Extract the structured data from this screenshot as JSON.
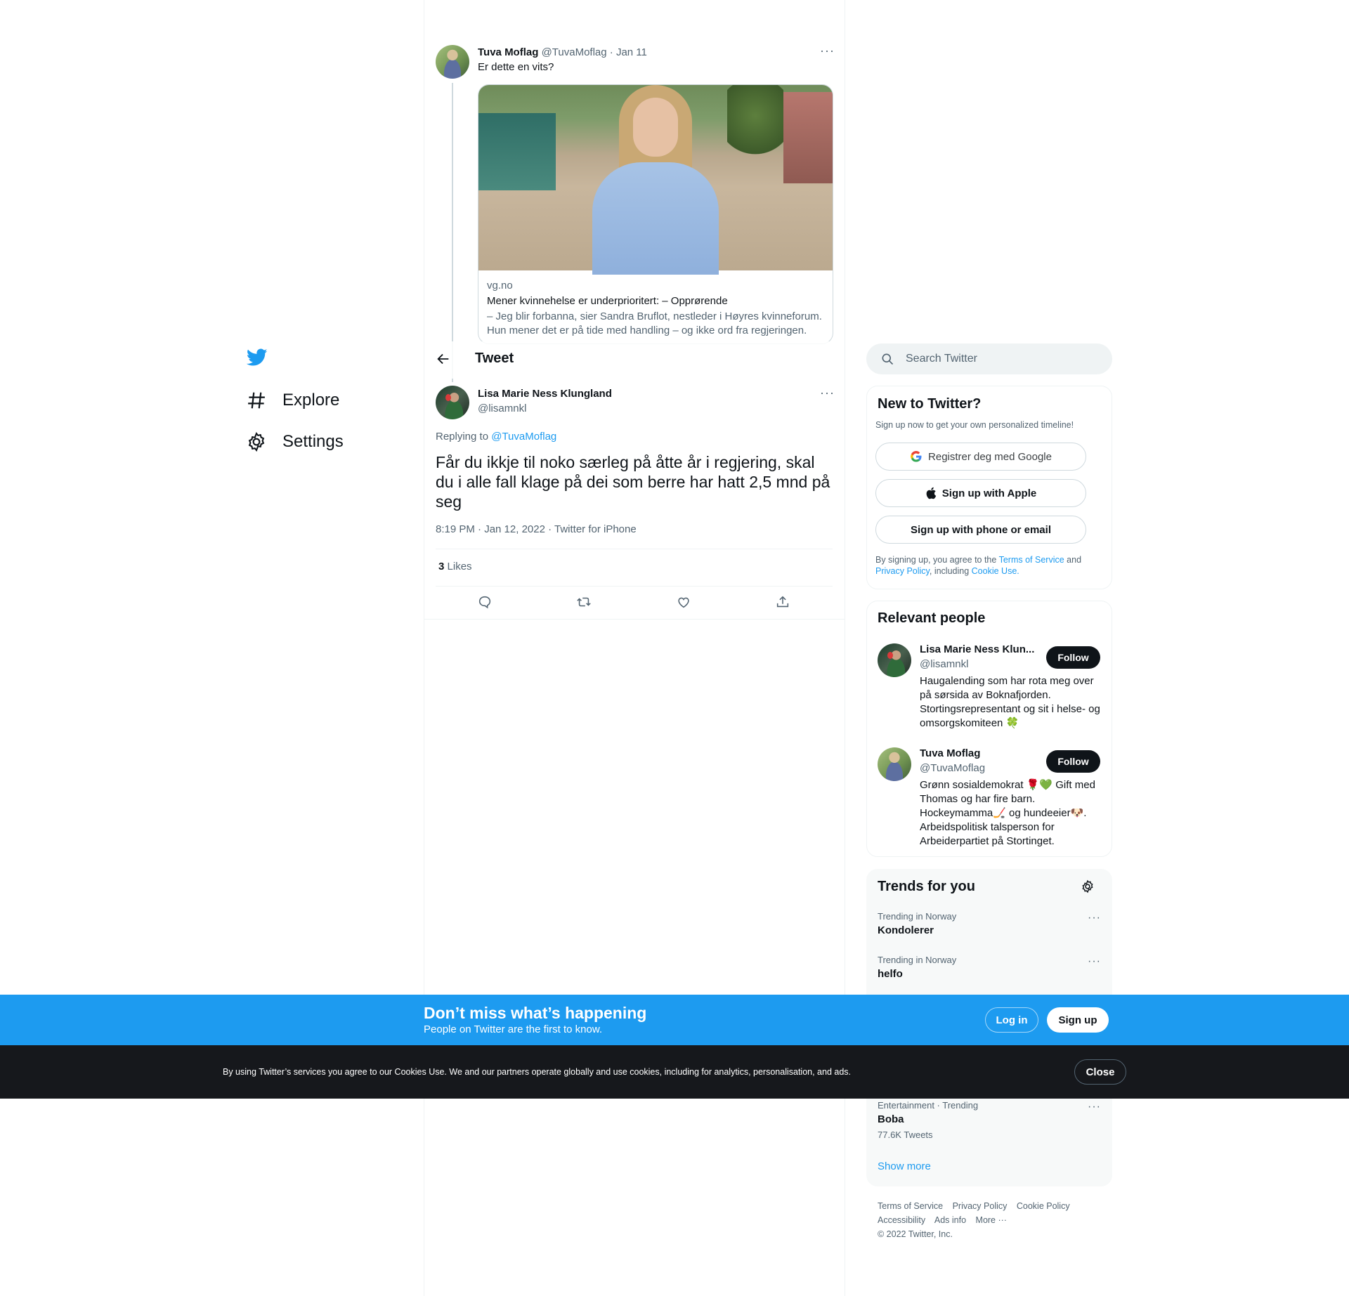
{
  "nav": {
    "explore_label": "Explore",
    "settings_label": "Settings"
  },
  "header": {
    "title": "Tweet"
  },
  "parent_tweet": {
    "name": "Tuva Moflag",
    "handle": "@TuvaMoflag",
    "date": "· Jan 11",
    "text": "Er dette en vits?",
    "card": {
      "domain": "vg.no",
      "title": "Mener kvinnehelse er underprioritert: – Opprørende",
      "description_line1": "– Jeg blir forbanna, sier Sandra Bruflot, nestleder i Høyres kvinneforum.",
      "description_line2": "Hun mener det er på tide med handling – og ikke ord fra regjeringen."
    }
  },
  "main_tweet": {
    "name": "Lisa Marie Ness Klungland",
    "handle": "@lisamnkl",
    "replying_prefix": "Replying to",
    "replying_to": "@TuvaMoflag",
    "text": "Får du ikkje til noko særleg på åtte år i regjering, skal du i alle fall klage på dei som berre har hatt 2,5 mnd på seg",
    "meta": "8:19 PM · Jan 12, 2022 · Twitter for iPhone",
    "likes_count": "3",
    "likes_label": "Likes"
  },
  "search": {
    "placeholder": "Search Twitter"
  },
  "signup": {
    "title": "New to Twitter?",
    "subtitle": "Sign up now to get your own personalized timeline!",
    "google_label": "Registrer deg med Google",
    "apple_label": "Sign up with Apple",
    "phone_label": "Sign up with phone or email",
    "legal_prefix": "By signing up, you agree to the",
    "terms": "Terms of Service",
    "and": "and",
    "privacy": "Privacy Policy",
    "including": ", including",
    "cookie": "Cookie Use."
  },
  "relevant": {
    "title": "Relevant people",
    "people": [
      {
        "name": "Lisa Marie Ness Klun...",
        "handle": "@lisamnkl",
        "follow_label": "Follow",
        "bio": "Haugalending som har rota meg over på sørsida av Boknafjorden. Stortingsrepresentant og sit i helse- og omsorgskomiteen 🍀"
      },
      {
        "name": "Tuva Moflag",
        "handle": "@TuvaMoflag",
        "follow_label": "Follow",
        "bio": "Grønn sosialdemokrat 🌹💚 Gift med Thomas og har fire barn. Hockeymamma🏒 og hundeeier🐶. Arbeidspolitisk talsperson for Arbeiderpartiet på Stortinget."
      }
    ]
  },
  "trends": {
    "title": "Trends for you",
    "items": [
      {
        "context": "Trending in Norway",
        "name": "Kondolerer"
      },
      {
        "context": "Trending in Norway",
        "name": "helfo"
      },
      {
        "context": "Entertainment · Trending",
        "name": "Boba",
        "count": "77.6K Tweets"
      }
    ],
    "show_more": "Show more"
  },
  "footer": {
    "terms": "Terms of Service",
    "privacy": "Privacy Policy",
    "cookie": "Cookie Policy",
    "accessibility": "Accessibility",
    "ads": "Ads info",
    "more": "More ···",
    "copyright": "© 2022 Twitter, Inc."
  },
  "banner": {
    "title": "Don’t miss what’s happening",
    "subtitle": "People on Twitter are the first to know.",
    "login_label": "Log in",
    "signup_label": "Sign up"
  },
  "cookie_bar": {
    "text": "By using Twitter’s services you agree to our Cookies Use. We and our partners operate globally and use cookies, including for analytics, personalisation, and ads.",
    "close_label": "Close"
  },
  "colors": {
    "accent": "#1d9bf0",
    "text_primary": "#0f1419",
    "text_secondary": "#536471",
    "cookie_bg": "#16181c"
  }
}
